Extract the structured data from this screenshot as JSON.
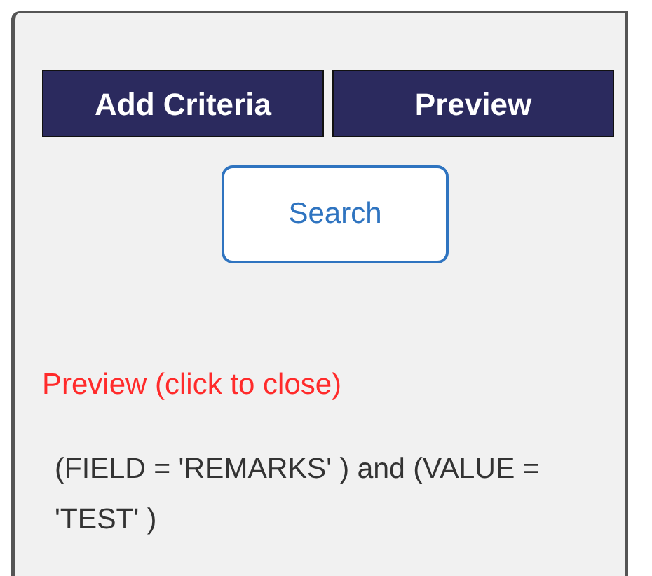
{
  "buttons": [
    {
      "label": "Add Criteria"
    },
    {
      "label": "Preview"
    }
  ],
  "search_button": {
    "label": "Search"
  },
  "preview_link": "Preview (click to close)",
  "preview_text": "(FIELD = 'REMARKS' ) and (VALUE = 'TEST' )"
}
